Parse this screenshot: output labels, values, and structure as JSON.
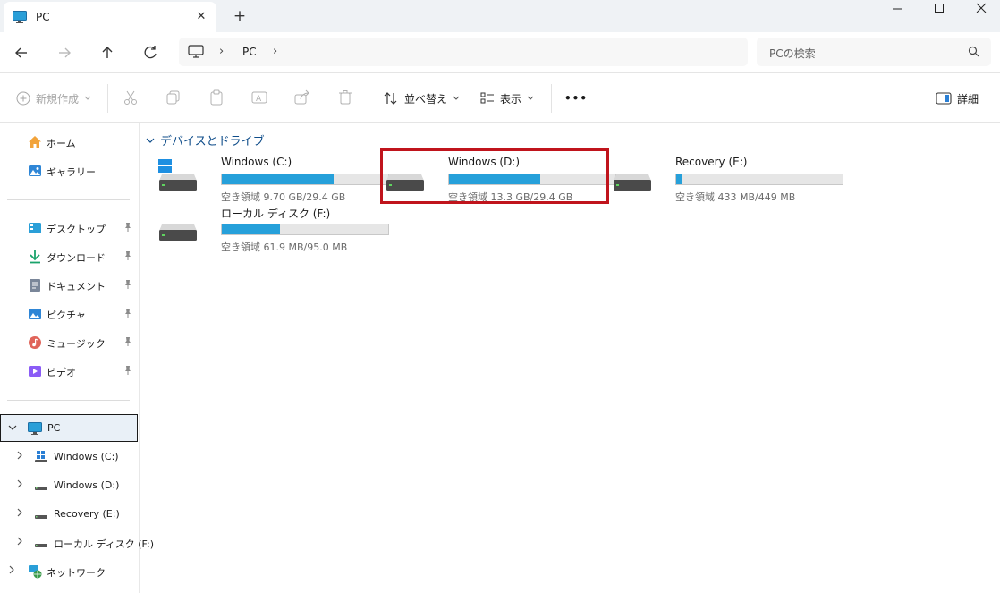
{
  "window": {
    "tab_title": "PC",
    "tab_close": "✕",
    "new_tab": "+",
    "minimize": "─",
    "maximize": "☐",
    "close": "✕"
  },
  "address": {
    "crumbs": [
      "PC"
    ],
    "separator": "›",
    "search_placeholder": "PCの検索"
  },
  "toolbar": {
    "new_label": "新規作成",
    "sort_label": "並べ替え",
    "view_label": "表示",
    "more_label": "•••",
    "details_label": "詳細"
  },
  "sidebar": {
    "top": [
      {
        "label": "ホーム",
        "icon": "home-icon"
      },
      {
        "label": "ギャラリー",
        "icon": "gallery-icon"
      }
    ],
    "pinned": [
      {
        "label": "デスクトップ",
        "icon": "desktop-icon",
        "color": "#2a9fd8"
      },
      {
        "label": "ダウンロード",
        "icon": "download-icon",
        "color": "#1aa36b"
      },
      {
        "label": "ドキュメント",
        "icon": "document-icon",
        "color": "#7a8699"
      },
      {
        "label": "ピクチャ",
        "icon": "pictures-icon",
        "color": "#2f86d6"
      },
      {
        "label": "ミュージック",
        "icon": "music-icon",
        "color": "#e0645a"
      },
      {
        "label": "ビデオ",
        "icon": "video-icon",
        "color": "#8b5cf6"
      }
    ],
    "pin_glyph": "📌",
    "pc_label": "PC",
    "drives": [
      {
        "label": "Windows (C:)"
      },
      {
        "label": "Windows (D:)"
      },
      {
        "label": "Recovery (E:)"
      },
      {
        "label": "ローカル ディスク (F:)"
      }
    ],
    "network_label": "ネットワーク"
  },
  "content": {
    "group_title": "デバイスとドライブ",
    "drives": [
      {
        "name": "Windows (C:)",
        "free_text": "空き領域 9.70 GB/29.4 GB",
        "used_fraction": 0.67,
        "windows_logo": true
      },
      {
        "name": "Windows (D:)",
        "free_text": "空き領域 13.3 GB/29.4 GB",
        "used_fraction": 0.55,
        "highlighted": true
      },
      {
        "name": "Recovery (E:)",
        "free_text": "空き領域 433 MB/449 MB",
        "used_fraction": 0.04
      },
      {
        "name": "ローカル ディスク (F:)",
        "free_text": "空き領域 61.9 MB/95.0 MB",
        "used_fraction": 0.35
      }
    ]
  },
  "colors": {
    "accent": "#26a0da",
    "highlight_border": "#c0141c",
    "group_title": "#0f4d8a"
  }
}
